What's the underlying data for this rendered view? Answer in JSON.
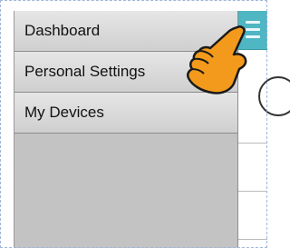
{
  "sidebar": {
    "items": [
      {
        "label": "Dashboard"
      },
      {
        "label": "Personal Settings"
      },
      {
        "label": "My Devices"
      }
    ]
  },
  "header": {
    "menu_icon": "hamburger-menu-icon",
    "accent_color": "#4fb6c4"
  },
  "overlay": {
    "cursor_icon": "tap-hand-icon",
    "cursor_color": "#f39a1c"
  }
}
